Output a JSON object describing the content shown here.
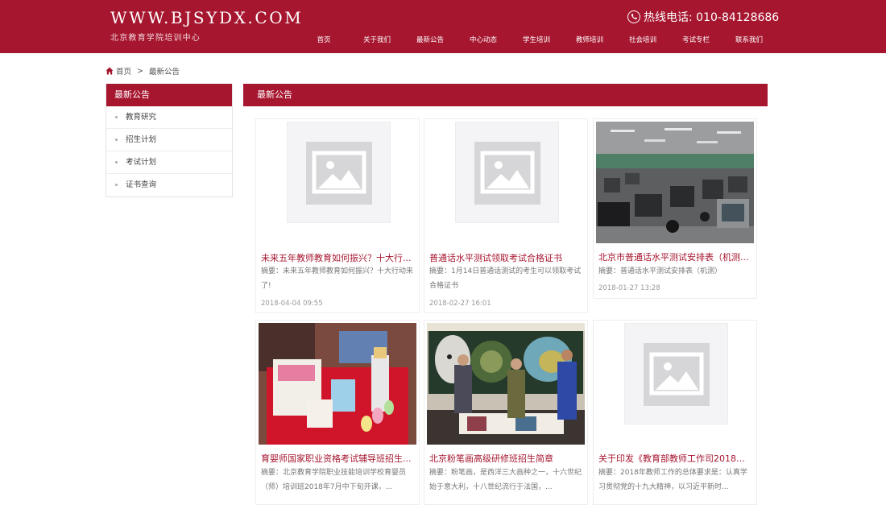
{
  "header": {
    "logo_main": "WWW.BJSYDX.COM",
    "logo_sub": "北京教育学院培训中心",
    "hotline": "热线电话: 010-84128686",
    "nav": [
      "首页",
      "关于我们",
      "最新公告",
      "中心动态",
      "学生培训",
      "教师培训",
      "社会培训",
      "考试专栏",
      "联系我们"
    ]
  },
  "breadcrumb": {
    "home": "首页",
    "sep": ">",
    "current": "最新公告"
  },
  "sidebar": {
    "title": "最新公告",
    "items": [
      "教育研究",
      "招生计划",
      "考试计划",
      "证书查询"
    ]
  },
  "main": {
    "title": "最新公告"
  },
  "articles": [
    {
      "title": "未来五年教师教育如何振兴？十大行...",
      "summary": "摘要：未来五年教师教育如何振兴？十大行动来了!",
      "date": "2018-04-04 09:55",
      "image": "placeholder"
    },
    {
      "title": "普通话水平测试领取考试合格证书",
      "summary": "摘要：1月14日普通话测试的考生可以领取考试合格证书",
      "date": "2018-02-27 16:01",
      "image": "placeholder"
    },
    {
      "title": "北京市普通话水平测试安排表（机测...",
      "summary": "摘要：普通话水平测试安排表（机测）",
      "date": "2018-01-27 13:28",
      "image": "computer-lab-photo"
    },
    {
      "title": "育婴师国家职业资格考试辅导班招生...",
      "summary": "摘要：北京教育学院职业技能培训学校育婴员（师）培训班2018年7月中下旬开课，...",
      "date": "",
      "image": "baby-supplies-photo"
    },
    {
      "title": "北京粉笔画高级研修班招生简章",
      "summary": "摘要：粉笔画，是西洋三大画种之一，十六世纪始于意大利，十八世纪流行于法国，...",
      "date": "",
      "image": "chalk-art-class-photo"
    },
    {
      "title": "关于印发《教育部教师工作司2018年...",
      "summary": "摘要：2018年教师工作的总体要求是：认真学习贯彻党的十九大精神，以习近平新时...",
      "date": "",
      "image": "placeholder"
    }
  ],
  "colors": {
    "brand": "#a6162f",
    "title_text": "#a6162f"
  }
}
